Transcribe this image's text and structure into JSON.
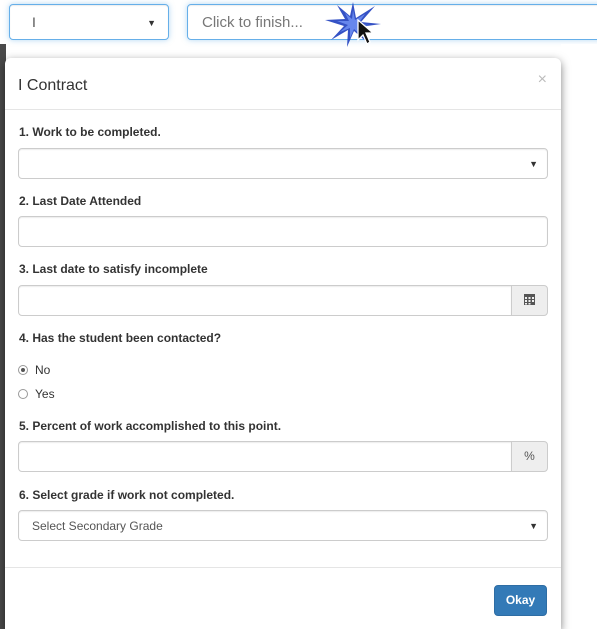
{
  "topbar": {
    "grade_value": "I",
    "finish_placeholder": "Click to finish..."
  },
  "modal": {
    "title": "I Contract",
    "close_glyph": "×",
    "questions": [
      {
        "label": "1. Work to be completed.",
        "value": ""
      },
      {
        "label": "2. Last Date Attended",
        "value": ""
      },
      {
        "label": "3. Last date to satisfy incomplete",
        "value": ""
      },
      {
        "label": "4. Has the student been contacted?",
        "options": [
          "No",
          "Yes"
        ],
        "selected": "No"
      },
      {
        "label": "5. Percent of work accomplished to this point.",
        "value": "",
        "addon": "%"
      },
      {
        "label": "6. Select grade if work not completed.",
        "value": "Select Secondary Grade"
      }
    ],
    "okay_label": "Okay"
  },
  "icons": {
    "dropdown": "chevron-down-icon",
    "calendar": "calendar-icon",
    "close": "close-icon",
    "cursor": "cursor-icon"
  },
  "colors": {
    "primary": "#337ab7",
    "focus_border": "#66afe9",
    "burst": "#1f3fbf"
  }
}
